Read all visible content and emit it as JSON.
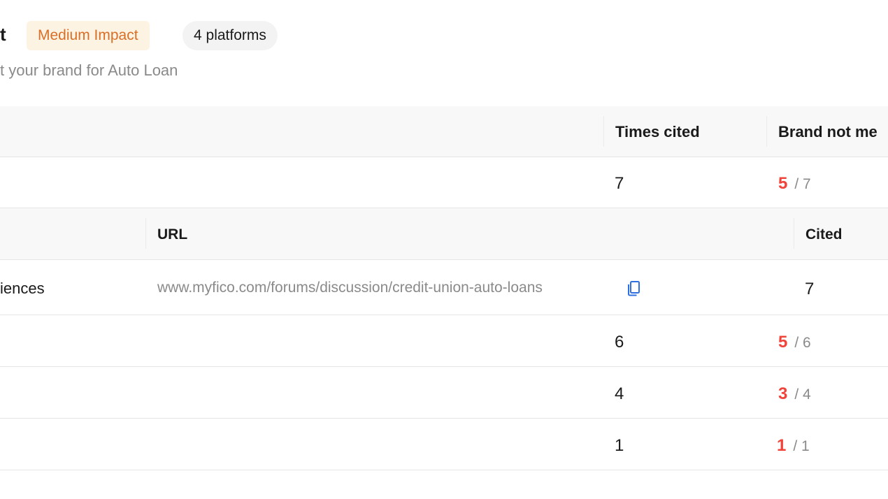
{
  "header": {
    "title_fragment": "t",
    "impact_badge": "Medium Impact",
    "platforms_badge": "4 platforms",
    "subtitle": "t your brand for Auto Loan"
  },
  "table": {
    "columns": {
      "times_cited": "Times cited",
      "brand_not_mentioned": "Brand not me"
    },
    "rows": [
      {
        "times_cited": "7",
        "missing": "5",
        "of": "/ 7"
      },
      {
        "times_cited": "6",
        "missing": "5",
        "of": "/ 6"
      },
      {
        "times_cited": "4",
        "missing": "3",
        "of": "/ 4"
      },
      {
        "times_cited": "1",
        "missing": "1",
        "of": "/ 1"
      }
    ]
  },
  "expanded": {
    "columns": {
      "url": "URL",
      "cited": "Cited"
    },
    "row": {
      "title_fragment": "iences",
      "url": "www.myfico.com/forums/discussion/credit-union-auto-loans",
      "cited": "7"
    }
  },
  "colors": {
    "accent_red": "#f0443a",
    "impact_bg": "#fdf3e3",
    "impact_text": "#d96f27",
    "link_icon": "#2f6fe0"
  }
}
